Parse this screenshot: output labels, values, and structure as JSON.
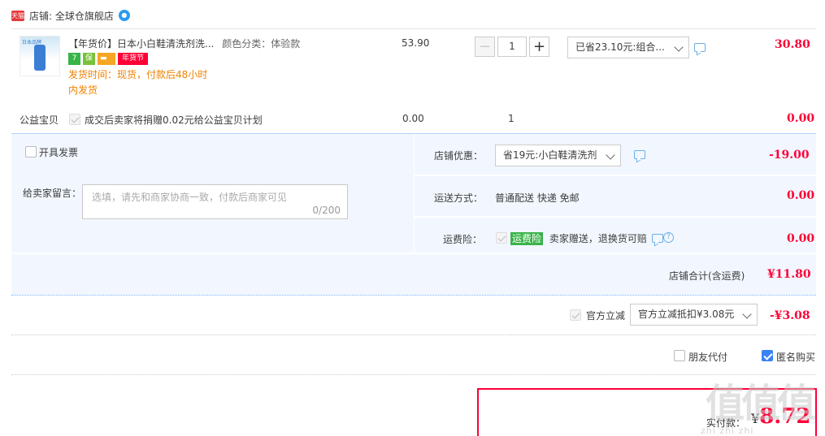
{
  "shop": {
    "badge": "天猫",
    "label": "店铺: 全球仓旗舰店",
    "ww_icon": "ww-chat-icon"
  },
  "item": {
    "thumb_label": "日本品牌",
    "title": "【年货价】日本小白鞋清洗剂洗...",
    "sku": "颜色分类：体验款",
    "badge_7": "7",
    "badge_guarantee": "保",
    "badge_nianhuo": "年货节",
    "ship_time_1": "发货时间：现货，付款后48小时",
    "ship_time_2": "内发货",
    "unit_price": "53.90",
    "quantity": "1",
    "minus": "−",
    "plus": "+",
    "discount_select": "已省23.10元:组合...",
    "subtotal": "30.80"
  },
  "charity": {
    "label": "公益宝贝",
    "text": "成交后卖家将捐赠0.02元给公益宝贝计划",
    "price": "0.00",
    "qty": "1",
    "subtotal": "0.00"
  },
  "options": {
    "invoice": "开具发票",
    "message_label": "给卖家留言：",
    "message_placeholder": "选填，请先和商家协商一致，付款后商家可见",
    "message_count": "0/200",
    "shop_discount_label": "店铺优惠：",
    "shop_discount_select": "省19元:小白鞋清洗剂",
    "shop_discount_value": "-19.00",
    "shipping_label": "运送方式：",
    "shipping_text": "普通配送 快递 免邮",
    "shipping_value": "0.00",
    "insurance_label": "运费险：",
    "insurance_tag": "运费险",
    "insurance_text": "卖家赠送，退换货可赔",
    "insurance_value": "0.00",
    "shop_total_label": "店铺合计(含运费)",
    "shop_total_value": "¥11.80"
  },
  "official": {
    "label": "官方立减",
    "select": "官方立减抵扣¥3.08元",
    "value": "-¥3.08"
  },
  "extras": {
    "friend_pay": "朋友代付",
    "anonymous": "匿名购买"
  },
  "payment": {
    "label": "实付款：",
    "yen": "¥",
    "value": "8.72"
  },
  "watermark": {
    "text": "值值值",
    "sub": "zhi zhi zhi"
  },
  "colors": {
    "accent_red": "#ff0036",
    "orange": "#f08200",
    "panel_blue": "#f2f7ff"
  }
}
